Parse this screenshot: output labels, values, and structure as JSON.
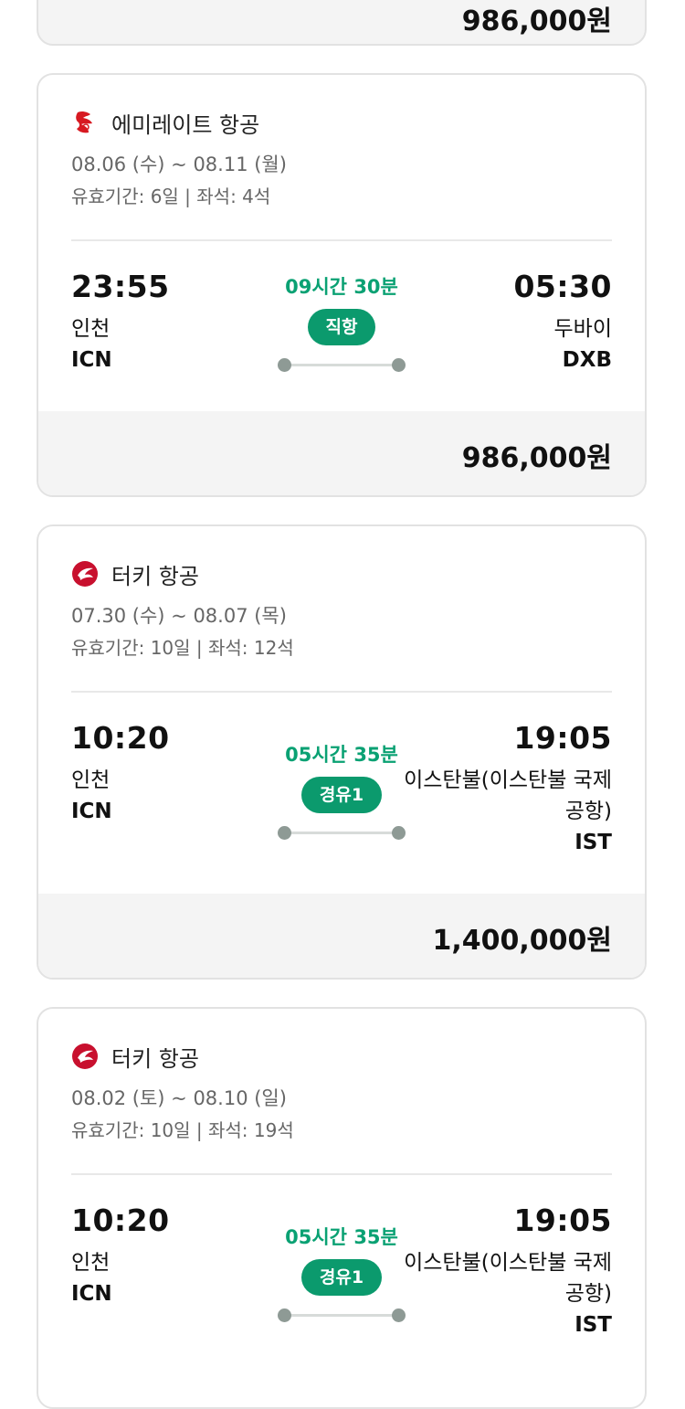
{
  "partial_card": {
    "price": "986,000원"
  },
  "cards": [
    {
      "airline": "에미레이트 항공",
      "airline_logo": "emirates-logo",
      "dates": "08.06 (수) ~ 08.11 (월)",
      "validity": "유효기간: 6일 | 좌석: 4석",
      "dep_time": "23:55",
      "dep_city": "인천",
      "dep_code": "ICN",
      "duration": "09시간 30분",
      "stops": "직항",
      "arr_time": "05:30",
      "arr_city": "두바이",
      "arr_code": "DXB",
      "price": "986,000원"
    },
    {
      "airline": "터키 항공",
      "airline_logo": "turkish-airlines-logo",
      "dates": "07.30 (수) ~ 08.07 (목)",
      "validity": "유효기간: 10일 | 좌석: 12석",
      "dep_time": "10:20",
      "dep_city": "인천",
      "dep_code": "ICN",
      "duration": "05시간 35분",
      "stops": "경유1",
      "arr_time": "19:05",
      "arr_city": "이스탄불(이스탄불 국제공항)",
      "arr_code": "IST",
      "price": "1,400,000원"
    },
    {
      "airline": "터키 항공",
      "airline_logo": "turkish-airlines-logo",
      "dates": "08.02 (토) ~ 08.10 (일)",
      "validity": "유효기간: 10일 | 좌석: 19석",
      "dep_time": "10:20",
      "dep_city": "인천",
      "dep_code": "ICN",
      "duration": "05시간 35분",
      "stops": "경유1",
      "arr_time": "19:05",
      "arr_city": "이스탄불(이스탄불 국제공항)",
      "arr_code": "IST"
    }
  ],
  "colors": {
    "accent": "#0b9a6d",
    "duration": "#0aa173",
    "emirates_red": "#d71921",
    "turkish_red": "#c8102e"
  }
}
